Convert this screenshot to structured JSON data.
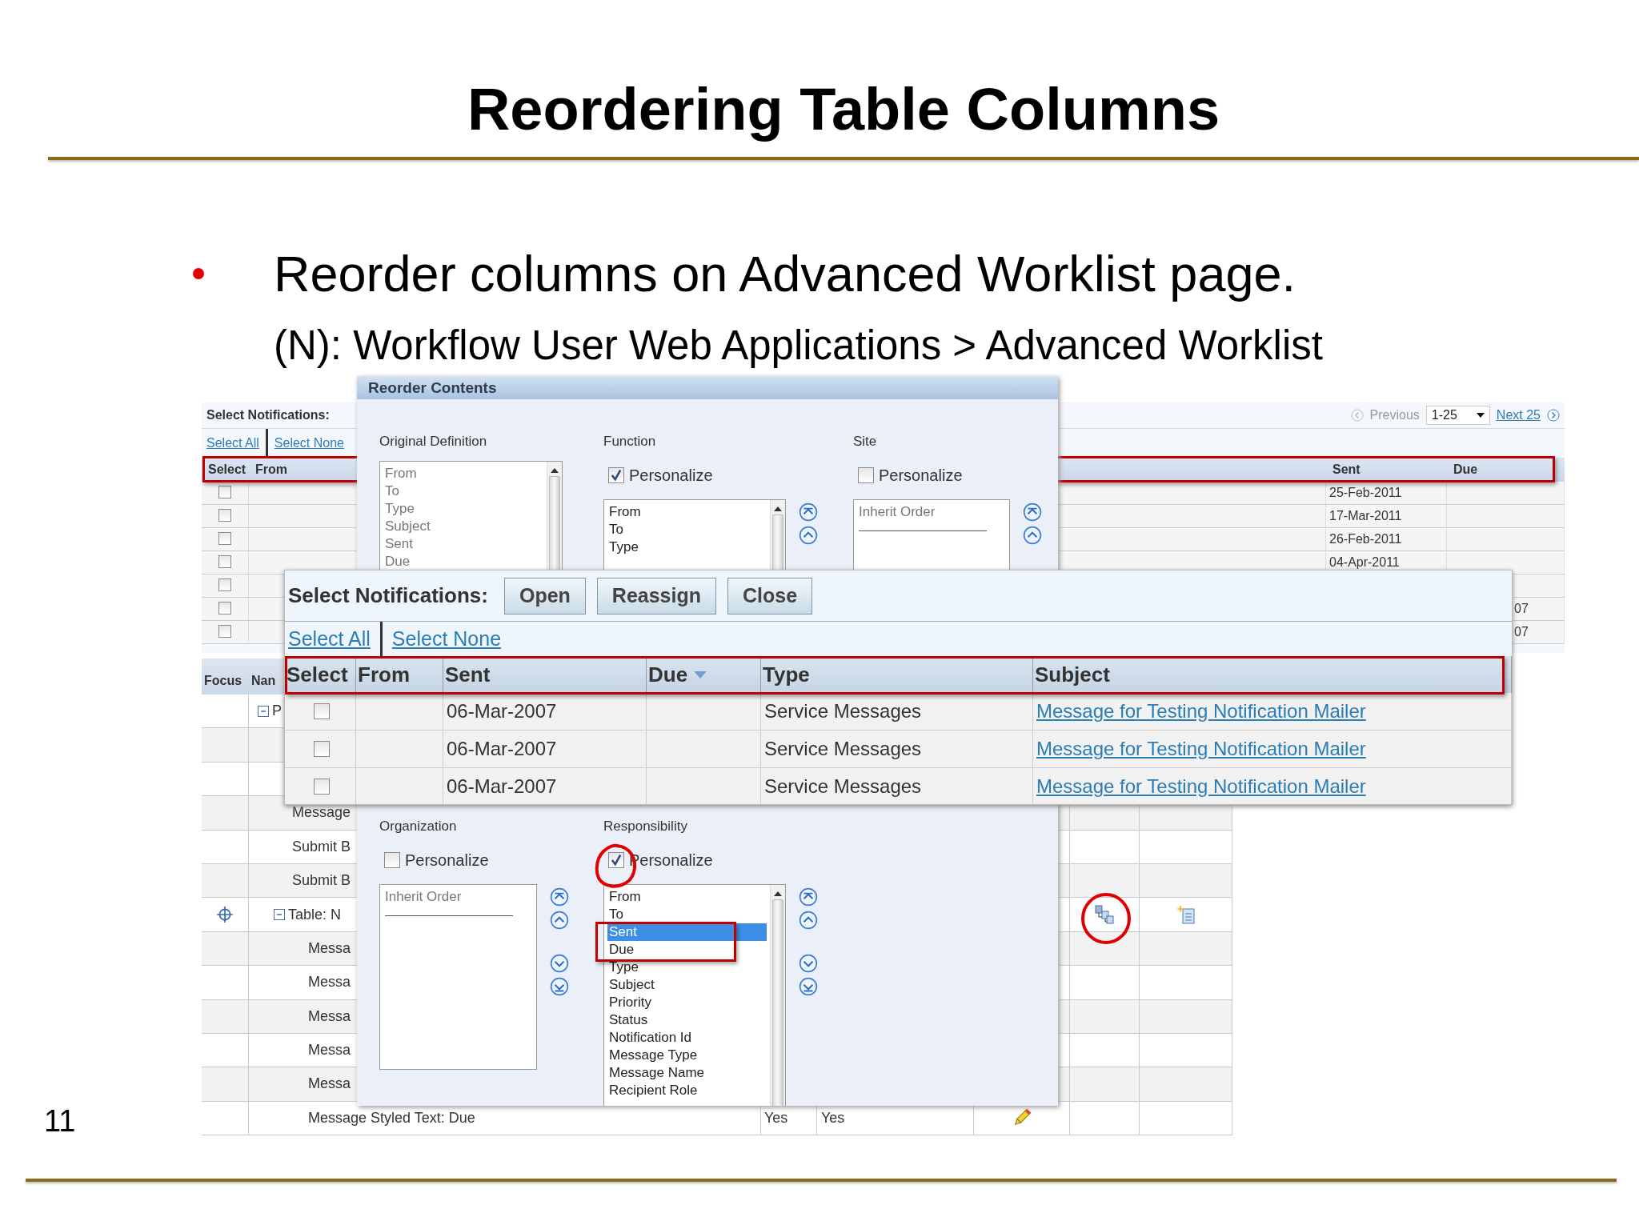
{
  "slide": {
    "title": "Reordering Table Columns",
    "bullet": "Reorder columns on Advanced Worklist page.",
    "path": "(N): Workflow User Web Applications > Advanced Worklist",
    "page_number": "11"
  },
  "worklist": {
    "label": "Select Notifications:",
    "previous": "Previous",
    "range": "1-25",
    "next": "Next 25",
    "select_all": "Select All",
    "select_none": "Select None",
    "columns": [
      "Select",
      "From",
      "Sent",
      "Due"
    ],
    "rows": [
      {
        "checked": false,
        "sent": "25-Feb-2011"
      },
      {
        "checked": false,
        "sent": "17-Mar-2011"
      },
      {
        "checked": false,
        "sent": "26-Feb-2011"
      },
      {
        "checked": false,
        "sent": "04-Apr-2011"
      },
      {
        "checked": false
      },
      {
        "checked": false,
        "due": "07"
      },
      {
        "checked": false,
        "due": "07"
      }
    ]
  },
  "personalization": {
    "columns": [
      "Focus",
      "Nan"
    ],
    "tree": [
      {
        "label": "P",
        "kind": "region",
        "expanded": true,
        "children": [
          {
            "label": "Message",
            "kind": "item"
          },
          {
            "label": "Submit B",
            "kind": "item"
          },
          {
            "label": "Submit B",
            "kind": "item"
          },
          {
            "label": "Table: N",
            "kind": "table",
            "expanded": true,
            "children": [
              {
                "label": "Messa",
                "kind": "item"
              },
              {
                "label": "Messa",
                "kind": "item"
              },
              {
                "label": "Messa",
                "kind": "item"
              },
              {
                "label": "Messa",
                "kind": "item"
              },
              {
                "label": "Messa",
                "kind": "item"
              },
              {
                "label": "Message Styled Text: Due",
                "kind": "editable",
                "column_3": "Yes",
                "column_4": "Yes"
              }
            ]
          }
        ]
      }
    ]
  },
  "reorder": {
    "title": "Reorder Contents",
    "top": [
      {
        "kind": "original",
        "label": "Original Definition",
        "items": [
          "From",
          "To",
          "Type",
          "Subject",
          "Sent",
          "Due"
        ]
      },
      {
        "kind": "personalized",
        "label": "Function",
        "personalize": {
          "label": "Personalize",
          "checked": true
        },
        "items": [
          {
            "label": "From",
            "selected": false
          },
          {
            "label": "To",
            "selected": false
          },
          {
            "label": "Type",
            "selected": false
          }
        ]
      },
      {
        "kind": "inherited",
        "label": "Site",
        "personalize": {
          "label": "Personalize",
          "checked": false
        },
        "inherit_text": "Inherit Order"
      }
    ],
    "bottom": [
      {
        "kind": "inherited",
        "label": "Organization",
        "personalize": {
          "label": "Personalize",
          "checked": false
        },
        "inherit_text": "Inherit Order"
      },
      {
        "kind": "personalized",
        "label": "Responsibility",
        "personalize": {
          "label": "Personalize",
          "checked": true
        },
        "items": [
          {
            "label": "From",
            "selected": false
          },
          {
            "label": "To",
            "selected": false
          },
          {
            "label": "Sent",
            "selected": true
          },
          {
            "label": "Due",
            "selected": false
          },
          {
            "label": "Type",
            "selected": false
          },
          {
            "label": "Subject",
            "selected": false
          },
          {
            "label": "Priority",
            "selected": false
          },
          {
            "label": "Status",
            "selected": false
          },
          {
            "label": "Notification Id",
            "selected": false
          },
          {
            "label": "Message Type",
            "selected": false
          },
          {
            "label": "Message Name",
            "selected": false
          },
          {
            "label": "Recipient Role",
            "selected": false
          }
        ]
      }
    ]
  },
  "notifications": {
    "label": "Select Notifications:",
    "buttons": [
      "Open",
      "Reassign",
      "Close"
    ],
    "select_all": "Select All",
    "select_none": "Select None",
    "columns": [
      {
        "label": "Select",
        "sorted": false
      },
      {
        "label": "From",
        "sorted": false
      },
      {
        "label": "Sent",
        "sorted": false
      },
      {
        "label": "Due",
        "sorted": true
      },
      {
        "label": "Type",
        "sorted": false
      },
      {
        "label": "Subject",
        "sorted": false
      }
    ],
    "rows": [
      {
        "checked": false,
        "sent": "06-Mar-2007",
        "type": "Service Messages",
        "subject": "Message for Testing Notification Mailer"
      },
      {
        "checked": false,
        "sent": "06-Mar-2007",
        "type": "Service Messages",
        "subject": "Message for Testing Notification Mailer"
      },
      {
        "checked": false,
        "sent": "06-Mar-2007",
        "type": "Service Messages",
        "subject": "Message for Testing Notification Mailer"
      }
    ]
  }
}
